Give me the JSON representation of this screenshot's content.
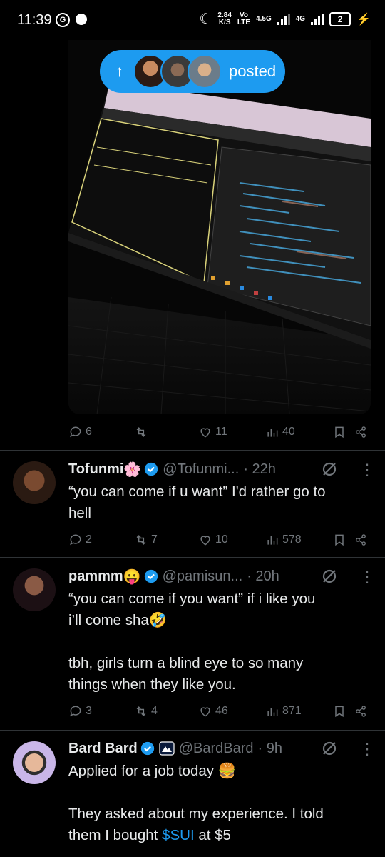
{
  "status_bar": {
    "time": "11:39",
    "net_speed": "2.84",
    "net_unit": "K/S",
    "volte": "Vo",
    "lte": "LTE",
    "sig1": "4.5G",
    "sig2": "4G",
    "battery": "2"
  },
  "feed_pill": {
    "label": "posted",
    "arrow": "↑"
  },
  "post1": {
    "replies": "6",
    "reposts": "",
    "likes": "11",
    "views": "40"
  },
  "tweets": [
    {
      "name": "Tofunmi",
      "emoji": "🌸",
      "handle": "@Tofunmi...",
      "time": "· 22h",
      "text": "“you can come if u want” I'd rather go to\nhell",
      "replies": "2",
      "reposts": "7",
      "likes": "10",
      "views": "578"
    },
    {
      "name": "pammm",
      "emoji": "😛",
      "handle": "@pamisun...",
      "time": "· 20h",
      "text": "“you can come if you want” if i like you\ni’ll come sha🤣\n\ntbh, girls turn a blind eye to so many\nthings when they like you.",
      "replies": "3",
      "reposts": "4",
      "likes": "46",
      "views": "871"
    },
    {
      "name": "Bard Bard",
      "emoji": "",
      "handle": "@BardBard",
      "time": "· 9h",
      "text_before": "Applied for a job today 🍔\n\nThey asked about my experience. I told\nthem I bought ",
      "cashtag": "$SUI",
      "text_after": " at $5"
    }
  ],
  "colors": {
    "accent": "#1d9bf0",
    "muted": "#71767b",
    "text": "#e7e9ea",
    "divider": "#2f3336"
  }
}
